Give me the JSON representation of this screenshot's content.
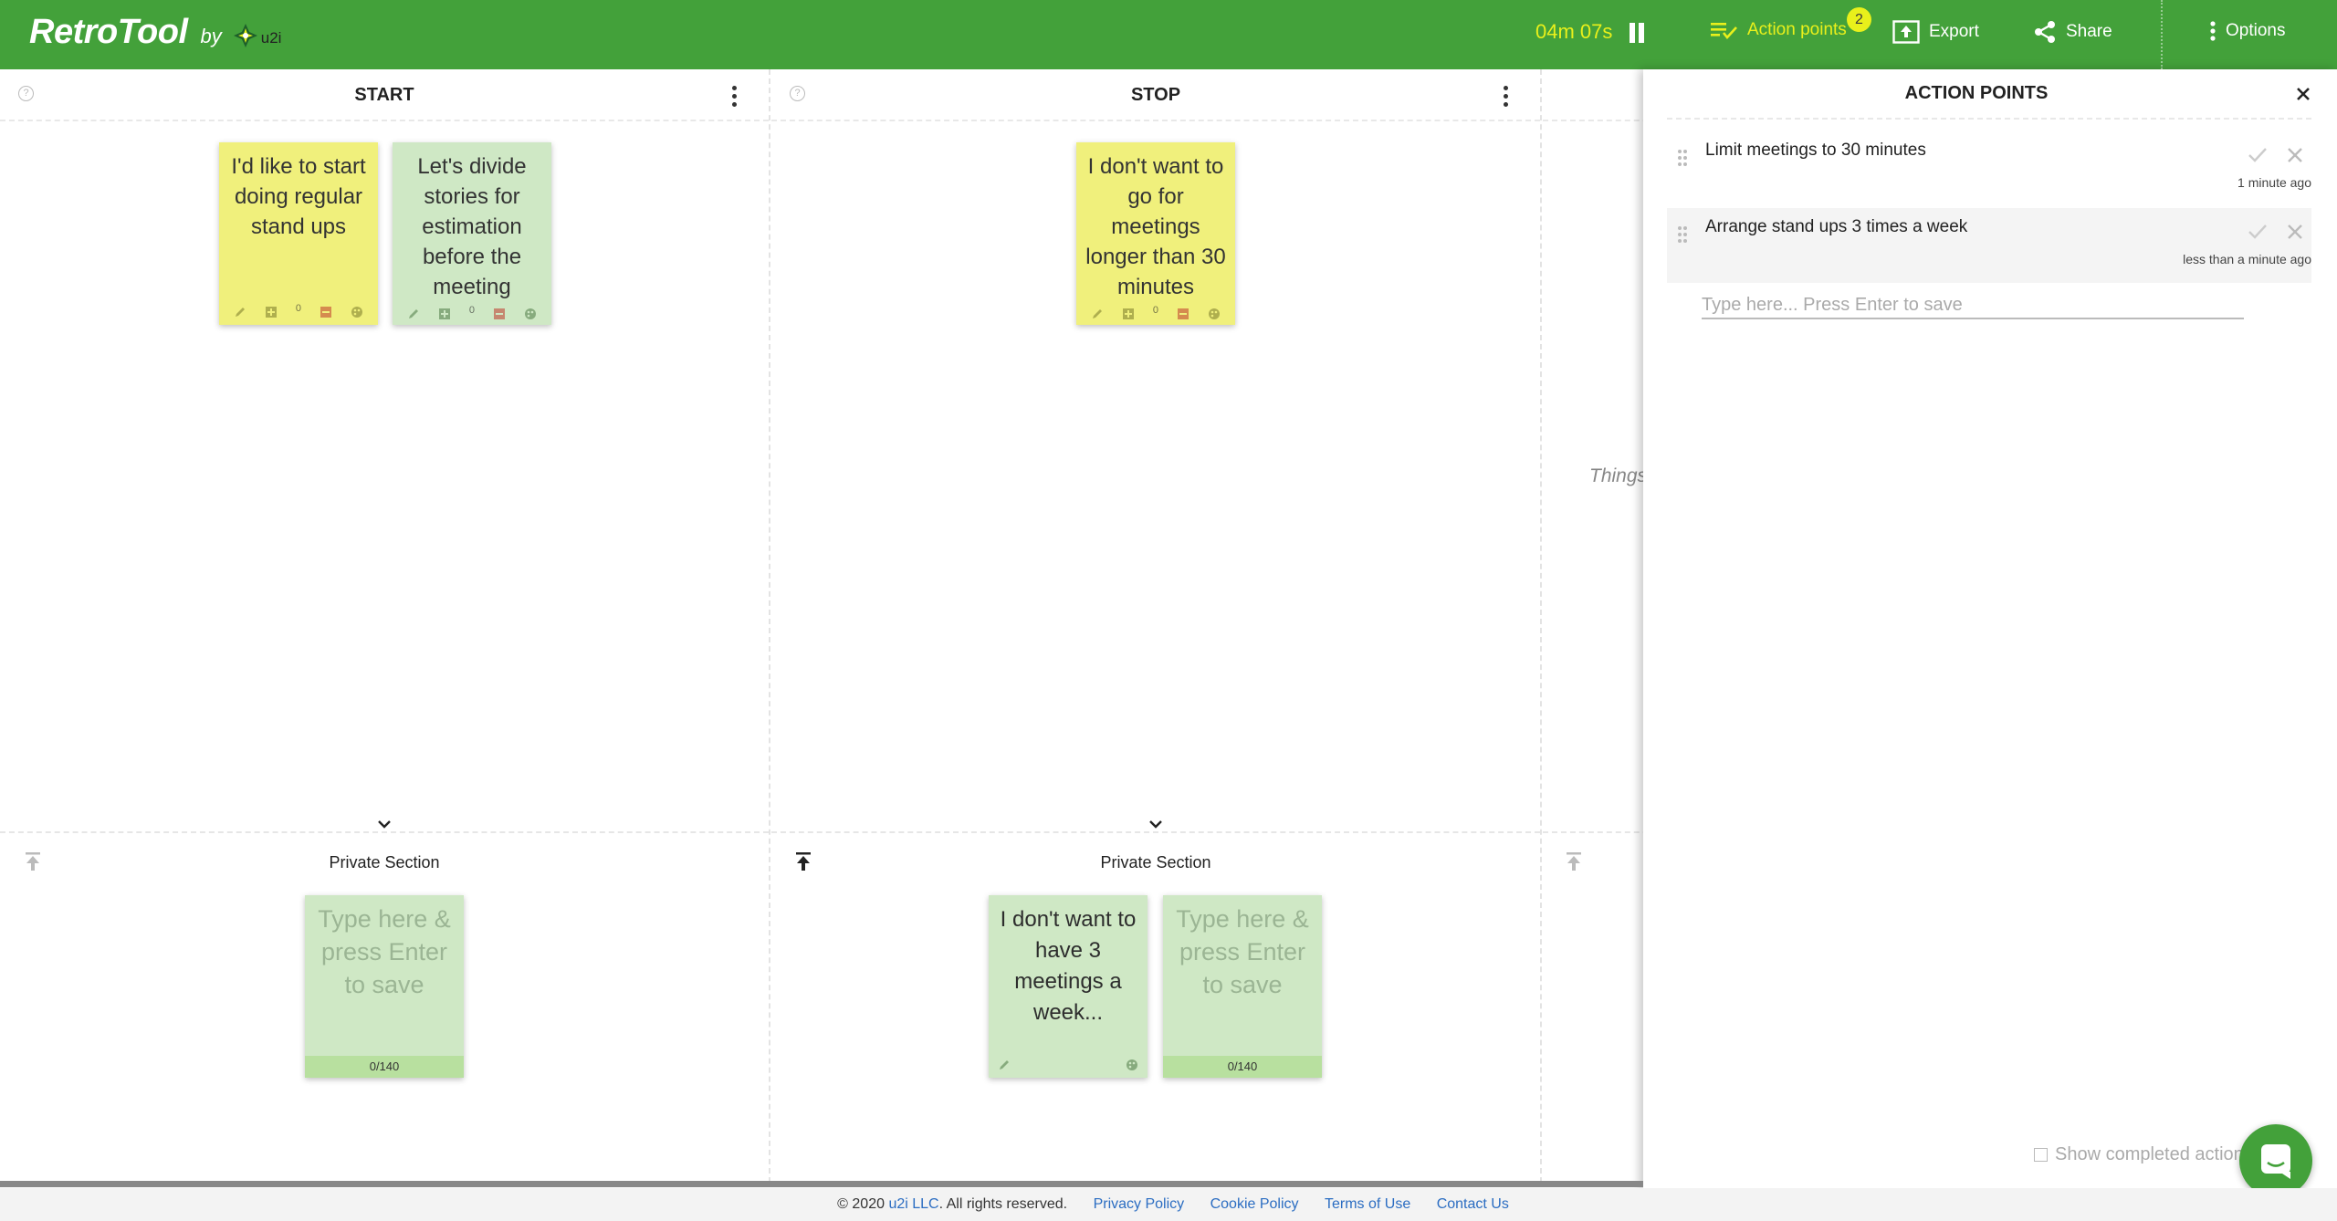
{
  "header": {
    "brand": "RetroTool",
    "by": "by",
    "company": "u2i",
    "timer": "04m 07s",
    "action_points_label": "Action points",
    "action_points_count": "2",
    "export_label": "Export",
    "share_label": "Share",
    "options_label": "Options"
  },
  "columns": [
    {
      "title": "START",
      "notes": [
        {
          "text": "I'd like to start doing regular stand ups",
          "color": "yellow",
          "votes": "0"
        },
        {
          "text": "Let's divide stories for estimation before the meeting",
          "color": "green",
          "votes": "0"
        }
      ],
      "private_title": "Private Section",
      "draft_placeholder": "Type here & press Enter to save",
      "draft_counter": "0/140"
    },
    {
      "title": "STOP",
      "notes": [
        {
          "text": "I don't want to go for meetings longer than 30 minutes",
          "color": "yellow",
          "votes": "0"
        }
      ],
      "private_title": "Private Section",
      "private_note": "I don't want to have 3 meetings a week...",
      "draft_placeholder": "Type here & press Enter to save",
      "draft_counter": "0/140"
    }
  ],
  "third_column_hint": "Things",
  "action_panel": {
    "title": "ACTION POINTS",
    "items": [
      {
        "text": "Limit meetings to 30 minutes",
        "time": "1 minute ago"
      },
      {
        "text": "Arrange stand ups 3 times a week",
        "time": "less than a minute ago"
      }
    ],
    "input_placeholder": "Type here... Press Enter to save",
    "show_completed_label": "Show completed actions"
  },
  "footer": {
    "copyright_pre": "© 2020",
    "company_link": "u2i LLC",
    "copyright_post": ". All rights reserved.",
    "privacy": "Privacy Policy",
    "cookie": "Cookie Policy",
    "terms": "Terms of Use",
    "contact": "Contact Us"
  },
  "colors": {
    "header_green": "#43a13a",
    "accent_yellow": "#e9f01b",
    "note_yellow": "#f0f07c",
    "note_green": "#cfe8c5"
  }
}
